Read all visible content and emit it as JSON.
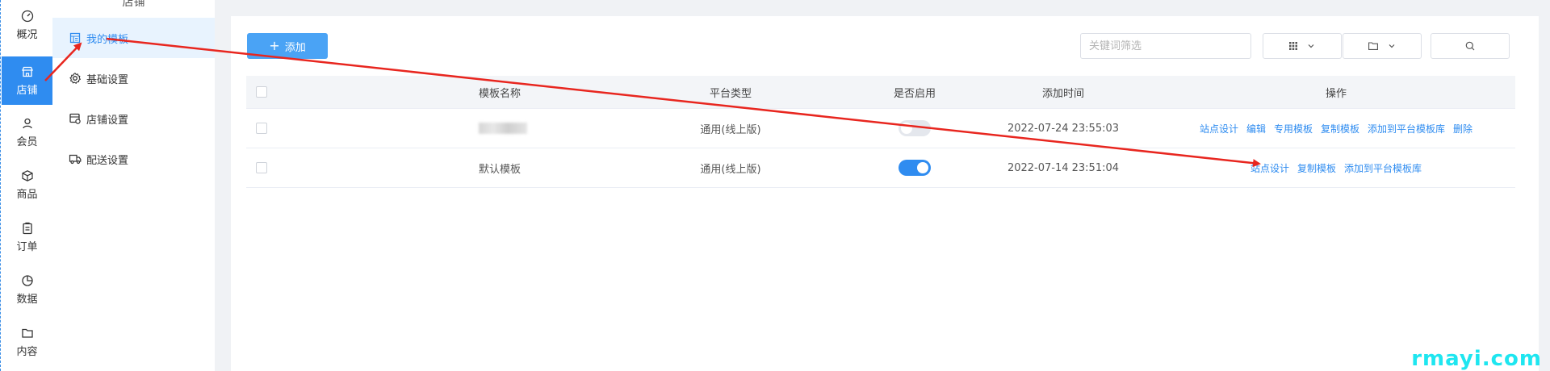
{
  "rail": {
    "items": [
      {
        "label": "概况",
        "icon": "dashboard-icon"
      },
      {
        "label": "店铺",
        "icon": "store-icon",
        "active": true
      },
      {
        "label": "会员",
        "icon": "user-icon"
      },
      {
        "label": "商品",
        "icon": "box-icon"
      },
      {
        "label": "订单",
        "icon": "clipboard-icon"
      },
      {
        "label": "数据",
        "icon": "pie-chart-icon"
      },
      {
        "label": "内容",
        "icon": "folder-icon"
      }
    ]
  },
  "submenu": {
    "title": "店铺",
    "items": [
      {
        "label": "我的模板",
        "icon": "template-icon",
        "active": true
      },
      {
        "label": "基础设置",
        "icon": "gear-icon"
      },
      {
        "label": "店铺设置",
        "icon": "shop-settings-icon"
      },
      {
        "label": "配送设置",
        "icon": "truck-icon"
      }
    ]
  },
  "toolbar": {
    "add_label": "添加",
    "search_placeholder": "关键词筛选"
  },
  "table": {
    "headers": {
      "name": "模板名称",
      "platform": "平台类型",
      "enabled": "是否启用",
      "time": "添加时间",
      "ops": "操作"
    },
    "rows": [
      {
        "name": "",
        "name_redacted": true,
        "platform": "通用(线上版)",
        "enabled": false,
        "time": "2022-07-24 23:55:03",
        "ops": [
          "站点设计",
          "编辑",
          "专用模板",
          "复制模板",
          "添加到平台模板库",
          "删除"
        ]
      },
      {
        "name": "默认模板",
        "name_redacted": false,
        "platform": "通用(线上版)",
        "enabled": true,
        "time": "2022-07-14 23:51:04",
        "ops": [
          "站点设计",
          "复制模板",
          "添加到平台模板库"
        ]
      }
    ]
  },
  "colors": {
    "accent": "#2f8cf0",
    "annotation_arrow": "#e8261f",
    "watermark": "#1ee6f0"
  },
  "watermark": "rmayi.com"
}
